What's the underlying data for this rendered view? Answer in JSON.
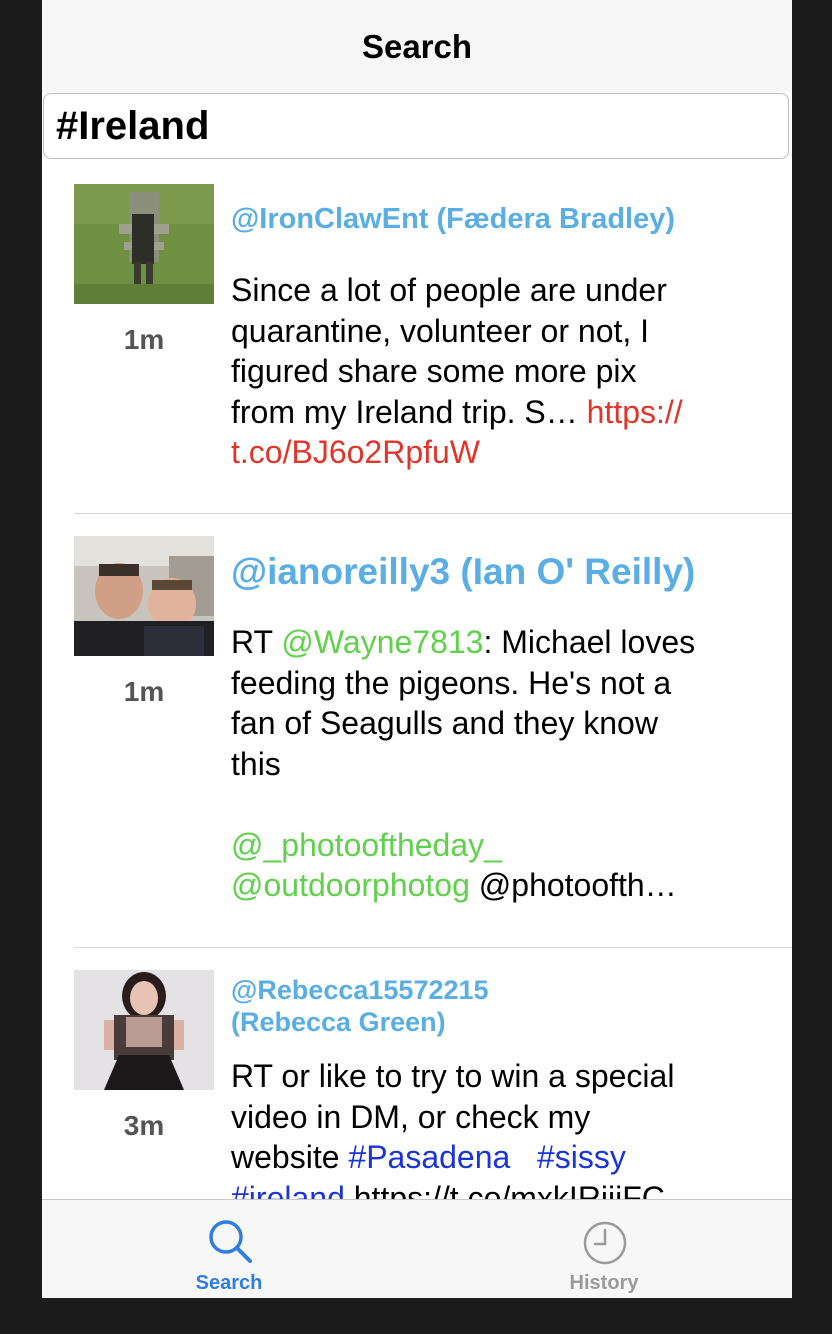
{
  "navbar": {
    "title": "Search"
  },
  "search": {
    "value": "#Ireland",
    "placeholder": ""
  },
  "tweets": [
    {
      "user": "@IronClawEnt (Fædera Bradley)",
      "time": "1m",
      "text": "Since a lot of people are under\nquarantine, volunteer or not, I\nfigured share some more pix\nfrom my Ireland trip. S… ",
      "link": "https://\nt.co/BJ6o2RpfuW"
    },
    {
      "user": "@ianoreilly3 (Ian O' Reilly)",
      "time": "1m",
      "text_prefix": "RT ",
      "mention1": "@Wayne7813",
      "text_mid": ": Michael loves\nfeeding the pigeons. He's not a\nfan of Seagulls and they know\nthis\n\n",
      "mention2": "@_photooftheday_",
      "mention3": "@outdoorphotog",
      "text_end": " @photoofth…"
    },
    {
      "user_line1": "@Rebecca15572215",
      "user_line2": "(Rebecca Green)",
      "time": "3m",
      "text": "RT or like to try to win a special\nvideo in DM, or check my\nwebsite ",
      "hashtag1": "#Pasadena",
      "hashtag2": "#sissy",
      "hashtag3": "#ireland",
      "text_end": " https://t.co/mxkIRjjjFC"
    }
  ],
  "tabbar": {
    "items": [
      {
        "label": "Search",
        "icon": "search-icon",
        "active": true
      },
      {
        "label": "History",
        "icon": "clock-icon",
        "active": false
      }
    ]
  },
  "colors": {
    "username": "#5aaee3",
    "link": "#e0352b",
    "mention": "#5fd14b",
    "hashtag": "#1b34d6",
    "tab_active": "#2f7de1",
    "tab_inactive": "#9a9a9a"
  }
}
